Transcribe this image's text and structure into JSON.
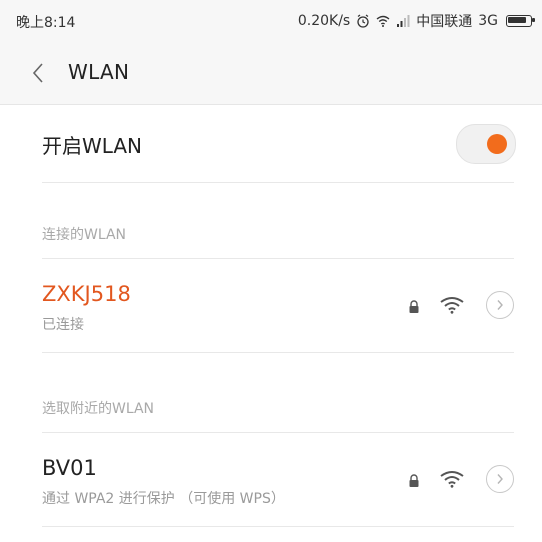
{
  "status_bar": {
    "time": "晚上8:14",
    "speed": "0.20K/s",
    "carrier": "中国联通",
    "network_type": "3G"
  },
  "header": {
    "title": "WLAN",
    "back_icon": "chevron-left-icon"
  },
  "wlan_toggle": {
    "label": "开启WLAN",
    "enabled": true,
    "accent_color": "#f26c1c"
  },
  "connected_section": {
    "header": "连接的WLAN",
    "network": {
      "name": "ZXKJ518",
      "status": "已连接",
      "name_color": "#e2571f"
    }
  },
  "nearby_section": {
    "header": "选取附近的WLAN",
    "networks": [
      {
        "name": "BV01",
        "security": "通过 WPA2 进行保护 （可使用 WPS）"
      }
    ]
  }
}
